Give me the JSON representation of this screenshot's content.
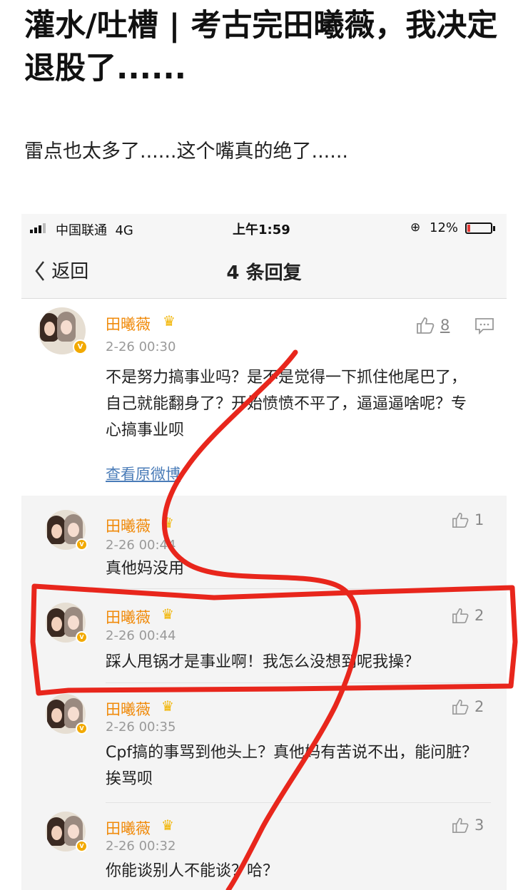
{
  "article": {
    "title": "灌水/吐槽 | 考古完田曦薇，我决定退股了......",
    "subtitle": "雷点也太多了......这个嘴真的绝了......"
  },
  "status_bar": {
    "carrier": "中国联通",
    "network": "4G",
    "time": "上午1:59",
    "battery": "12%",
    "battery_level": 0.12
  },
  "nav": {
    "back": "返回",
    "title": "4 条回复"
  },
  "main_comment": {
    "user": "田曦薇",
    "time": "2-26 00:30",
    "likes": "8",
    "text": "不是努力搞事业吗？是不是觉得一下抓住他尾巴了，自己就能翻身了？开始愤愤不平了，逼逼逼啥呢？专心搞事业呗",
    "view_original": "查看原微博"
  },
  "replies": [
    {
      "user": "田曦薇",
      "time": "2-26 00:44",
      "likes": "1",
      "text": "真他妈没用"
    },
    {
      "user": "田曦薇",
      "time": "2-26 00:44",
      "likes": "2",
      "text": "踩人甩锅才是事业啊！我怎么没想到呢我操？"
    },
    {
      "user": "田曦薇",
      "time": "2-26 00:35",
      "likes": "2",
      "text": "Cpf搞的事骂到他头上？真他妈有苦说不出，能问脏？挨骂呗"
    },
    {
      "user": "田曦薇",
      "time": "2-26 00:32",
      "likes": "3",
      "text": "你能谈别人不能谈？哈？"
    }
  ],
  "colors": {
    "username": "#f08a0a",
    "link": "#4a7cb8",
    "annotation": "#e8261c"
  },
  "icons": [
    "signal-icon",
    "lock-rotation-icon",
    "battery-icon",
    "back-chevron-icon",
    "crown-icon",
    "verified-badge-icon",
    "thumbs-up-icon",
    "comment-icon"
  ]
}
